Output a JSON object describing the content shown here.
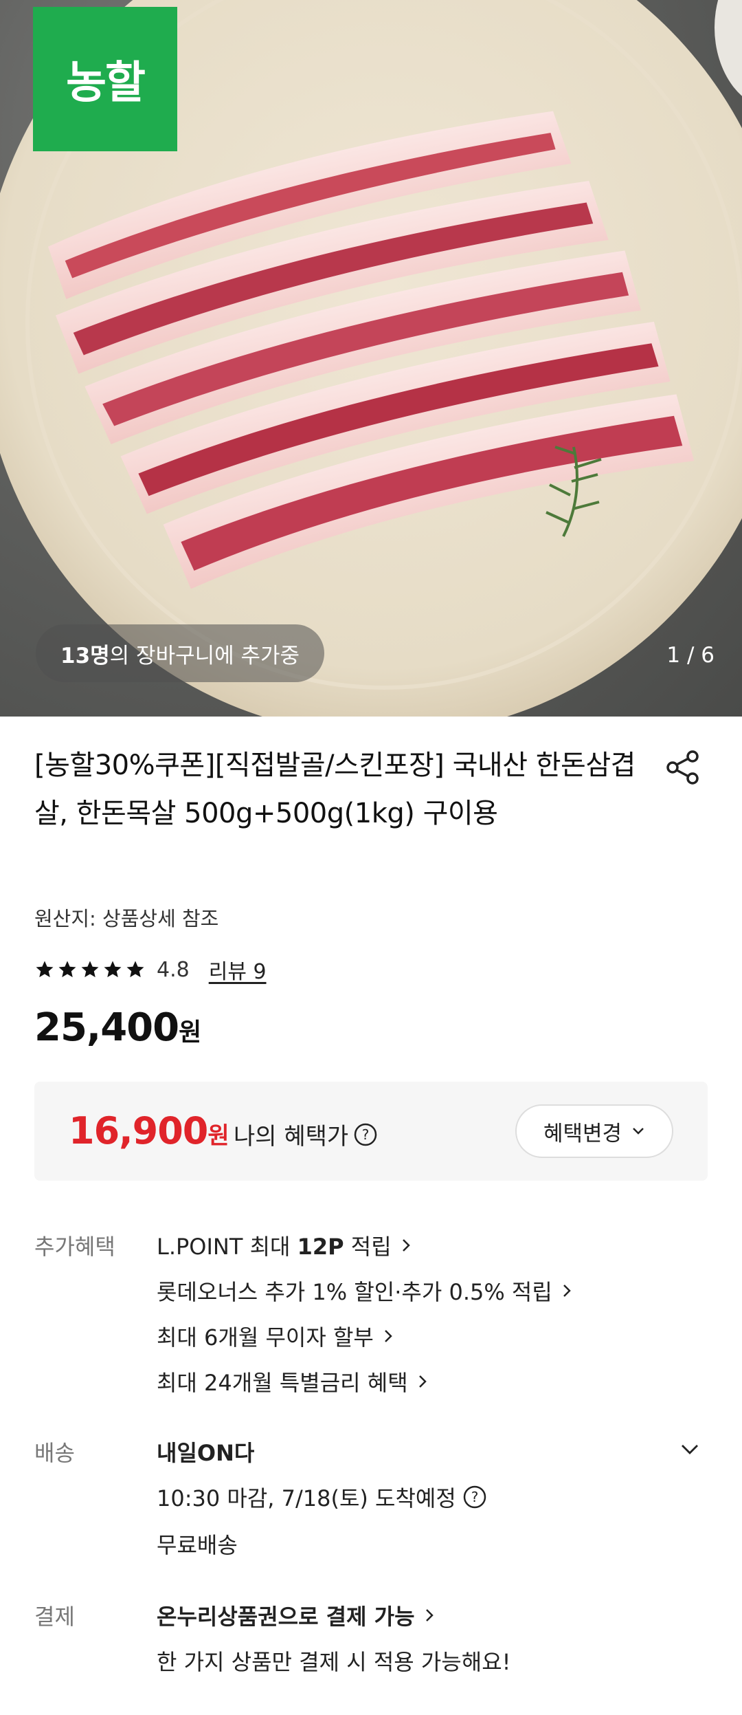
{
  "hero": {
    "brand_logo": "농할",
    "cart_count": "13명",
    "cart_text": "의 장바구니에 추가중",
    "page_indicator": "1 / 6"
  },
  "product": {
    "title": "[농할30%쿠폰][직접발골/스킨포장] 국내산 한돈삼겹살, 한돈목살 500g+500g(1kg) 구이용",
    "origin": "원산지: 상품상세 참조",
    "rating": "4.8",
    "rating_stars": 5,
    "review_link": "리뷰 9",
    "price": "25,400",
    "price_unit": "원"
  },
  "benefit": {
    "price": "16,900",
    "price_unit": "원",
    "label": "나의 혜택가",
    "change_button": "혜택변경"
  },
  "extra_benefits": {
    "label": "추가혜택",
    "lines": [
      {
        "pre": "L.POINT 최대 ",
        "bold": "12P",
        "post": " 적립"
      },
      {
        "pre": "롯데오너스 추가 1% 할인·추가 0.5% 적립",
        "bold": "",
        "post": ""
      },
      {
        "pre": "최대 6개월 무이자 할부",
        "bold": "",
        "post": ""
      },
      {
        "pre": "최대 24개월 특별금리 혜택",
        "bold": "",
        "post": ""
      }
    ]
  },
  "delivery": {
    "label": "배송",
    "title": "내일ON다",
    "eta": "10:30 마감, 7/18(토) 도착예정",
    "fee": "무료배송"
  },
  "payment": {
    "label": "결제",
    "title": "온누리상품권으로 결제 가능",
    "desc": "한 가지 상품만 결제 시 적용 가능해요!"
  },
  "colors": {
    "brand_green": "#1fac4e",
    "sale_red": "#e0242a",
    "benefit_bg": "#f6f6f6"
  },
  "icons": [
    "share-icon",
    "star-icon",
    "help-icon",
    "chevron-down-icon",
    "chevron-right-icon"
  ]
}
